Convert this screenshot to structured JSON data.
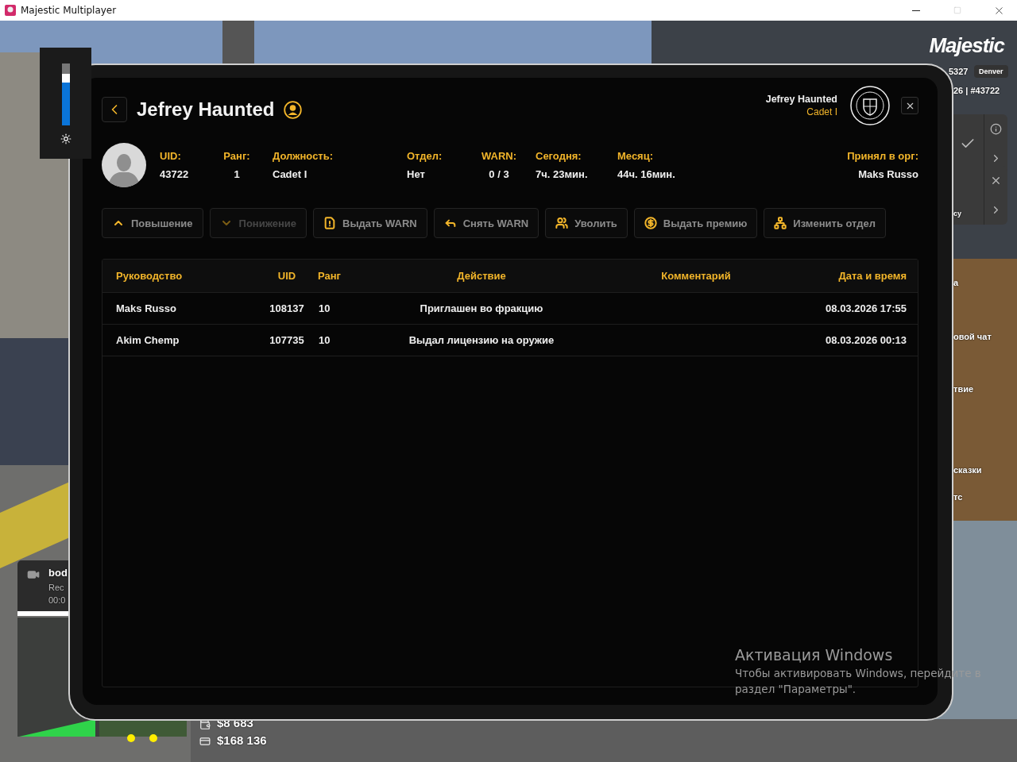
{
  "window": {
    "title": "Majestic Multiplayer",
    "maximize_disabled": true
  },
  "brightness": {
    "level": 0.83
  },
  "hud": {
    "logo": "Majestic",
    "server_id": "5327",
    "server_name": "Denver",
    "player_line": "26 | #43722",
    "side_fragments": [
      "су",
      "а",
      "овой чат",
      "твие",
      "сказки",
      "тс"
    ],
    "bodycam": {
      "title": "bod",
      "line1": "Rec",
      "line2": "00:0"
    },
    "cash": "$8 683",
    "bank": "$168 136"
  },
  "tablet": {
    "name": "Jefrey Haunted",
    "profile": {
      "name": "Jefrey Haunted",
      "rank": "Cadet I"
    },
    "stats": [
      {
        "label": "UID:",
        "value": "43722"
      },
      {
        "label": "Ранг:",
        "value": "1"
      },
      {
        "label": "Должность:",
        "value": "Cadet I"
      },
      {
        "label": "Отдел:",
        "value": "Нет"
      },
      {
        "label": "WARN:",
        "value": "0 / 3"
      },
      {
        "label": "Сегодня:",
        "value": "7ч. 23мин."
      },
      {
        "label": "Месяц:",
        "value": "44ч. 16мин."
      },
      {
        "label": "Принял в орг:",
        "value": "Maks Russo"
      }
    ],
    "actions": [
      {
        "kind": "promote",
        "label": "Повышение",
        "disabled": false
      },
      {
        "kind": "demote",
        "label": "Понижение",
        "disabled": true
      },
      {
        "kind": "warn",
        "label": "Выдать WARN",
        "disabled": false
      },
      {
        "kind": "unwarn",
        "label": "Снять WARN",
        "disabled": false
      },
      {
        "kind": "fire",
        "label": "Уволить",
        "disabled": false
      },
      {
        "kind": "bonus",
        "label": "Выдать премию",
        "disabled": false
      },
      {
        "kind": "transfer",
        "label": "Изменить отдел",
        "disabled": false
      }
    ],
    "table": {
      "columns": [
        "Руководство",
        "UID",
        "Ранг",
        "Действие",
        "Комментарий",
        "Дата и время"
      ],
      "rows": [
        {
          "leader": "Maks Russo",
          "uid": "108137",
          "rank": "10",
          "action": "Приглашен во фракцию",
          "datetime": "08.03.2026 17:55"
        },
        {
          "leader": "Akim Chemp",
          "uid": "107735",
          "rank": "10",
          "action": "Выдал лицензию на оружие",
          "datetime": "08.03.2026 00:13"
        }
      ]
    }
  },
  "os_notice": {
    "title": "Активация Windows",
    "line1": "Чтобы активировать Windows, перейдите в",
    "line2": "раздел \"Параметры\"."
  }
}
